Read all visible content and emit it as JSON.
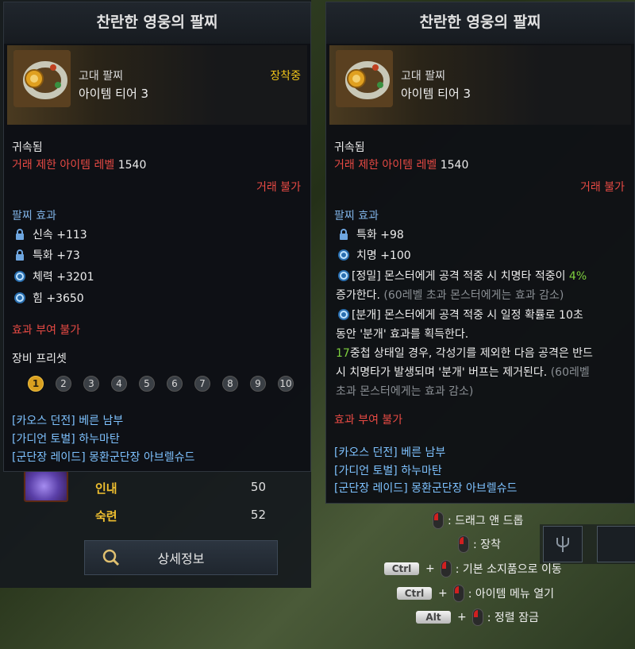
{
  "background": {
    "stats": [
      {
        "label": "인내",
        "value": "50"
      },
      {
        "label": "숙련",
        "value": "52"
      }
    ],
    "detail_button_label": "상세정보"
  },
  "left_tooltip": {
    "title": "찬란한 영웅의 팔찌",
    "item_kind": "고대 팔찌",
    "item_tier": "아이템 티어 3",
    "equipped_label": "장착중",
    "bound": "귀속됨",
    "trade_limit_label": "거래 제한 아이템 레벨",
    "trade_limit_value": "1540",
    "untradeable": "거래 불가",
    "effect_header": "팔찌 효과",
    "effects": [
      {
        "icon": "lock-icon",
        "text": "신속 +113"
      },
      {
        "icon": "lock-icon",
        "text": "특화 +73"
      },
      {
        "icon": "swirl-icon",
        "text": "체력 +3201"
      },
      {
        "icon": "swirl-icon",
        "text": "힘 +3650"
      }
    ],
    "cannot_grant": "효과 부여 불가",
    "preset_header": "장비 프리셋",
    "presets": [
      "1",
      "2",
      "3",
      "4",
      "5",
      "6",
      "7",
      "8",
      "9",
      "10"
    ],
    "sources": [
      {
        "tag": "[카오스 던전]",
        "name": "베른 남부"
      },
      {
        "tag": "[가디언 토벌]",
        "name": "하누마탄"
      },
      {
        "tag": "[군단장 레이드]",
        "name": "몽환군단장 아브렐슈드"
      }
    ]
  },
  "right_tooltip": {
    "title": "찬란한 영웅의 팔찌",
    "item_kind": "고대 팔찌",
    "item_tier": "아이템 티어 3",
    "bound": "귀속됨",
    "trade_limit_label": "거래 제한 아이템 레벨",
    "trade_limit_value": "1540",
    "untradeable": "거래 불가",
    "effect_header": "팔찌 효과",
    "effects": [
      {
        "icon": "lock-icon",
        "text": "특화 +98"
      },
      {
        "icon": "swirl-icon",
        "text": "치명 +100"
      }
    ],
    "precision": {
      "tag": "[정밀]",
      "text_a": " 몬스터에게 공격 적중 시 치명타 적중이 ",
      "value": "4%",
      "text_b": "증가한다.",
      "note": " (60레벨 초과 몬스터에게는 효과 감소)"
    },
    "rupture": {
      "tag": "[분개]",
      "line1": " 몬스터에게 공격 적중 시 일정 확률로 10초",
      "line2": "동안 '분개' 효과를 획득한다.",
      "stack": "17",
      "line3": "중첩 상태일 경우, 각성기를 제외한 다음 공격은 반드",
      "line4": "시 치명타가 발생되며 '분개' 버프는 제거된다.",
      "note1": " (60레벨",
      "note2": "초과 몬스터에게는 효과 감소)"
    },
    "cannot_grant": "효과 부여 불가",
    "sources": [
      {
        "tag": "[카오스 던전]",
        "name": "베른 남부"
      },
      {
        "tag": "[가디언 토벌]",
        "name": "하누마탄"
      },
      {
        "tag": "[군단장 레이드]",
        "name": "몽환군단장 아브렐슈드"
      }
    ]
  },
  "help": {
    "drag": ": 드래그 앤 드롭",
    "equip": ": 장착",
    "ctrl_key": "Ctrl",
    "move": ": 기본 소지품으로 이동",
    "open_menu": ": 아이템 메뉴 열기",
    "alt_key": "Alt",
    "lock": ": 정렬 잠금"
  },
  "colors": {
    "accent_gold": "#f0c419",
    "warning_red": "#e84a44",
    "header_blue": "#7fb2e5",
    "highlight_green": "#7ecf3e"
  }
}
